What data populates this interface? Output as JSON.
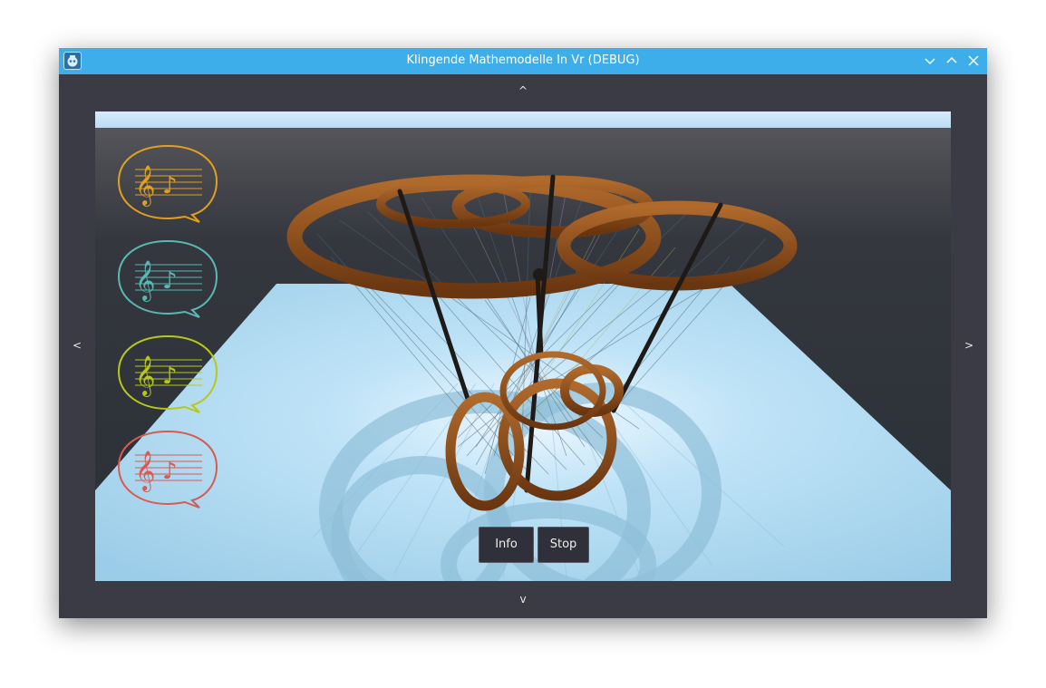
{
  "window": {
    "title": "Klingende Mathemodelle In Vr (DEBUG)",
    "icons": [
      "godot-app-icon",
      "minimize-icon",
      "maximize-icon",
      "close-icon"
    ]
  },
  "nav": {
    "up_label": "^",
    "down_label": "v",
    "left_label": "<",
    "right_label": ">"
  },
  "sound_bubbles": [
    {
      "name": "sound-bubble-orange",
      "color": "#e0a020"
    },
    {
      "name": "sound-bubble-teal",
      "color": "#5ab8b4"
    },
    {
      "name": "sound-bubble-lime",
      "color": "#b8c818"
    },
    {
      "name": "sound-bubble-red",
      "color": "#d85a50"
    }
  ],
  "buttons": {
    "info_label": "Info",
    "stop_label": "Stop"
  },
  "colors": {
    "titlebar": "#3daee9",
    "frame": "#3b3b45",
    "sky": "#c8e4f8",
    "floor": "#a8d6ee",
    "wood": "#8a4e1e"
  }
}
